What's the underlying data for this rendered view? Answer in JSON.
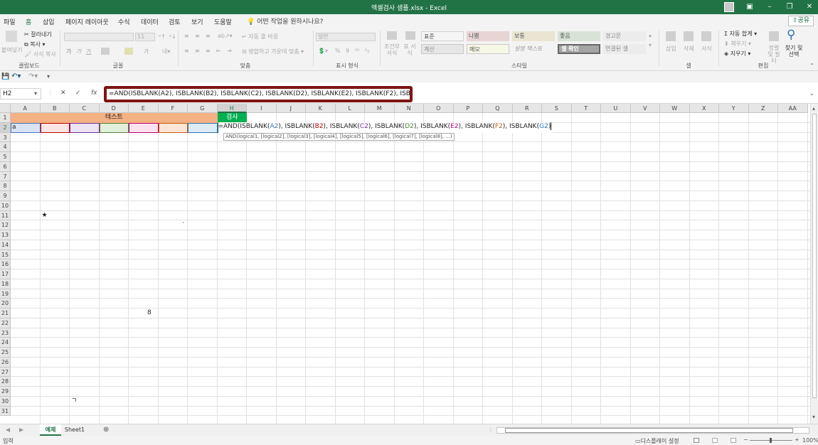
{
  "window": {
    "title": "엑셀검사 샘플.xlsx  -  Excel"
  },
  "tabs": [
    "파일",
    "홈",
    "삽입",
    "페이지 레이아웃",
    "수식",
    "데이터",
    "검토",
    "보기",
    "도움말"
  ],
  "tell_me": "어떤 작업을 원하시나요?",
  "share": "공유",
  "ribbon": {
    "clipboard": {
      "paste": "붙여넣기",
      "cut": "잘라내기",
      "copy": "복사",
      "format_painter": "서식 복사",
      "label": "클립보드"
    },
    "font": {
      "size": "11",
      "bold": "가",
      "italic": "가",
      "underline": "가",
      "font_color": "가",
      "label": "글꼴"
    },
    "alignment": {
      "wrap": "자동 줄 바꿈",
      "merge": "병합하고 가운데 맞춤",
      "label": "맞춤"
    },
    "number": {
      "format": "일반",
      "label": "표시 형식"
    },
    "styles": {
      "conditional": "조건부 서식",
      "table": "표 서식",
      "label": "스타일",
      "cells": [
        "표준",
        "나쁨",
        "보통",
        "좋음",
        "경고문",
        "계산",
        "메모",
        "설명 텍스트",
        "셀 확인",
        "연결된 셀"
      ]
    },
    "cells": {
      "insert": "삽입",
      "delete": "삭제",
      "format": "서식",
      "label": "셀"
    },
    "editing": {
      "autosum": "자동 합계",
      "fill": "채우기",
      "clear": "지우기",
      "sort": "정렬 및 필터",
      "find": "찾기 및 선택",
      "label": "편집"
    }
  },
  "formula_bar": {
    "name_box": "H2",
    "formula": "=AND(ISBLANK(A2), ISBLANK(B2), ISBLANK(C2), ISBLANK(D2), ISBLANK(E2), ISBLANK(F2), ISBLANK(G2)"
  },
  "columns": [
    "A",
    "B",
    "C",
    "D",
    "E",
    "F",
    "G",
    "H",
    "I",
    "J",
    "K",
    "L",
    "M",
    "N",
    "O",
    "P",
    "Q",
    "R",
    "S",
    "T",
    "U",
    "V",
    "W",
    "X",
    "Y",
    "Z",
    "AA"
  ],
  "rows": [
    1,
    2,
    3,
    4,
    5,
    6,
    7,
    8,
    9,
    10,
    11,
    12,
    13,
    14,
    15,
    16,
    17,
    18,
    19,
    20,
    21,
    22,
    23,
    24,
    25,
    26,
    27,
    28,
    29,
    30,
    31
  ],
  "cells": {
    "test_header": "테스트",
    "check_header": "검사",
    "a2": "a",
    "b11": "★",
    "f12": "·",
    "e21": "8",
    "c30": "ㄱ",
    "h2_parts": [
      {
        "t": "=AND(ISBLANK(",
        "c": "#222"
      },
      {
        "t": "A2",
        "c": "#4472c4"
      },
      {
        "t": "), ISBLANK(",
        "c": "#222"
      },
      {
        "t": "B2",
        "c": "#c00000"
      },
      {
        "t": "), ISBLANK(",
        "c": "#222"
      },
      {
        "t": "C2",
        "c": "#7030a0"
      },
      {
        "t": "), ISBLANK(",
        "c": "#222"
      },
      {
        "t": "D2",
        "c": "#548235"
      },
      {
        "t": "), ISBLANK(",
        "c": "#222"
      },
      {
        "t": "E2",
        "c": "#c00078"
      },
      {
        "t": "), ISBLANK(",
        "c": "#222"
      },
      {
        "t": "F2",
        "c": "#c55a11"
      },
      {
        "t": "), ISBLANK(",
        "c": "#222"
      },
      {
        "t": "G2",
        "c": "#2e75b6"
      },
      {
        "t": ")",
        "c": "#222"
      }
    ]
  },
  "tooltip": "AND(logical1, [logical2], [logical3], [logical4], [logical5], [logical6], [logical7], [logical8], ...)",
  "sheet_tabs": [
    "예제",
    "Sheet1"
  ],
  "status": {
    "mode": "입력",
    "display_settings": "디스플레이 설정",
    "zoom": "100%"
  },
  "colors": {
    "accent": "#217346",
    "test_fill": "#f4b183",
    "check_fill": "#00b050",
    "formula_border": "#7f1313"
  }
}
